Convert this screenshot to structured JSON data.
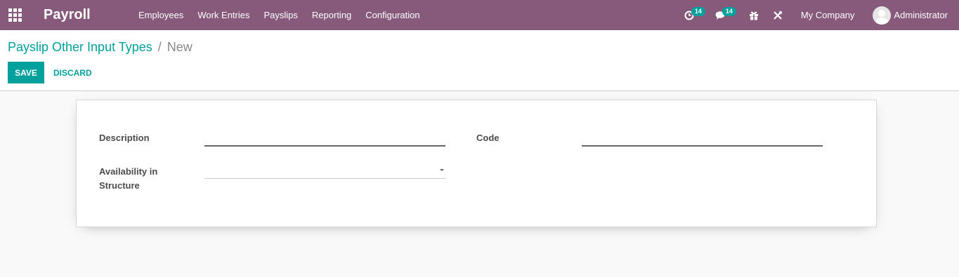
{
  "navbar": {
    "brand": "Payroll",
    "menu": [
      "Employees",
      "Work Entries",
      "Payslips",
      "Reporting",
      "Configuration"
    ],
    "activity_count": "14",
    "message_count": "14",
    "company": "My Company",
    "user": "Administrator",
    "icons": {
      "apps": "apps-grid-icon",
      "activity": "clock-icon",
      "messages": "chat-icon",
      "gift": "gift-icon",
      "debug": "tools-icon"
    }
  },
  "breadcrumb": {
    "parent": "Payslip Other Input Types",
    "separator": "/",
    "current": "New"
  },
  "buttons": {
    "save": "SAVE",
    "discard": "DISCARD"
  },
  "form": {
    "description_label": "Description",
    "description_value": "",
    "code_label": "Code",
    "code_value": "",
    "availability_label": "Availability in Structure",
    "availability_value": ""
  },
  "colors": {
    "navbar": "#875a7b",
    "accent": "#00a09d"
  }
}
